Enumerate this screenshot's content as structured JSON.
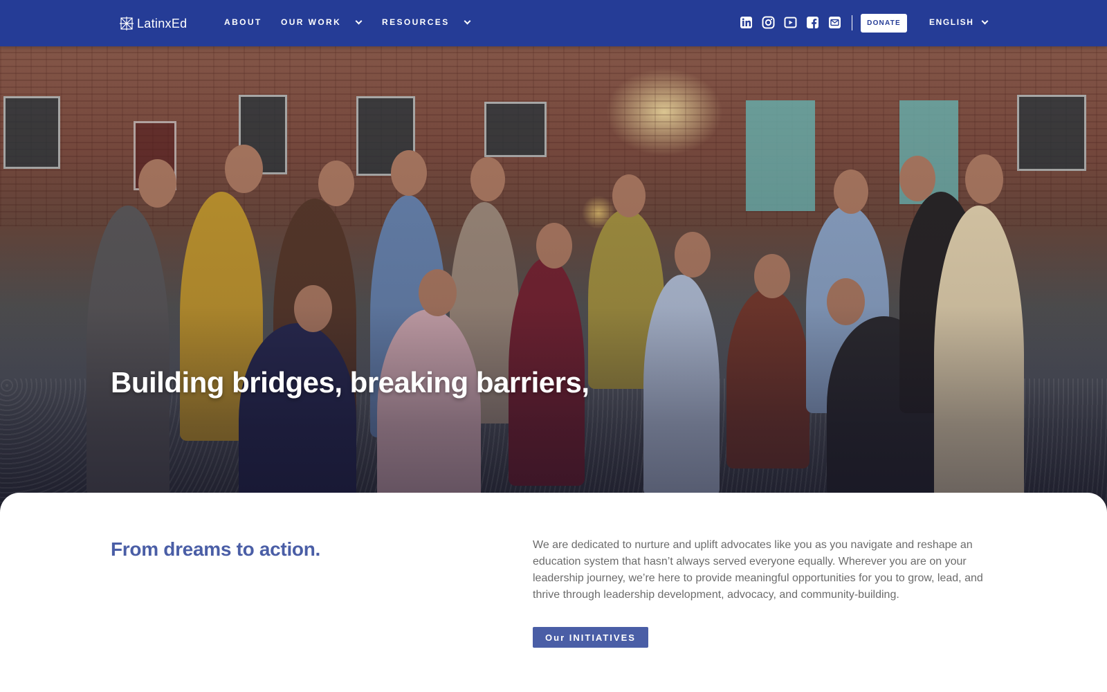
{
  "nav": {
    "logo_text": "LatinxEd",
    "links": [
      {
        "label": "ABOUT"
      },
      {
        "label": "OUR WORK"
      },
      {
        "label": "RESOURCES"
      }
    ],
    "social_icons": [
      "linkedin-icon",
      "instagram-icon",
      "youtube-icon",
      "facebook-icon",
      "email-icon"
    ],
    "donate_label": "DONATE",
    "language_label": "ENGLISH"
  },
  "hero": {
    "headline": "Building bridges, breaking barriers,"
  },
  "intro": {
    "heading": "From dreams to action.",
    "body": "We are dedicated to nurture and uplift advocates like you as you navigate and reshape an education system that hasn’t always served everyone equally. Wherever you are on your leadership journey, we’re here to provide meaningful opportunities for you to grow, lead, and thrive through leadership development, advocacy, and community-building.",
    "cta_label": "Our INITIATIVES"
  },
  "colors": {
    "nav_bg": "#253c96",
    "accent": "#4a5ea6",
    "body_text": "#6b6b6b"
  }
}
